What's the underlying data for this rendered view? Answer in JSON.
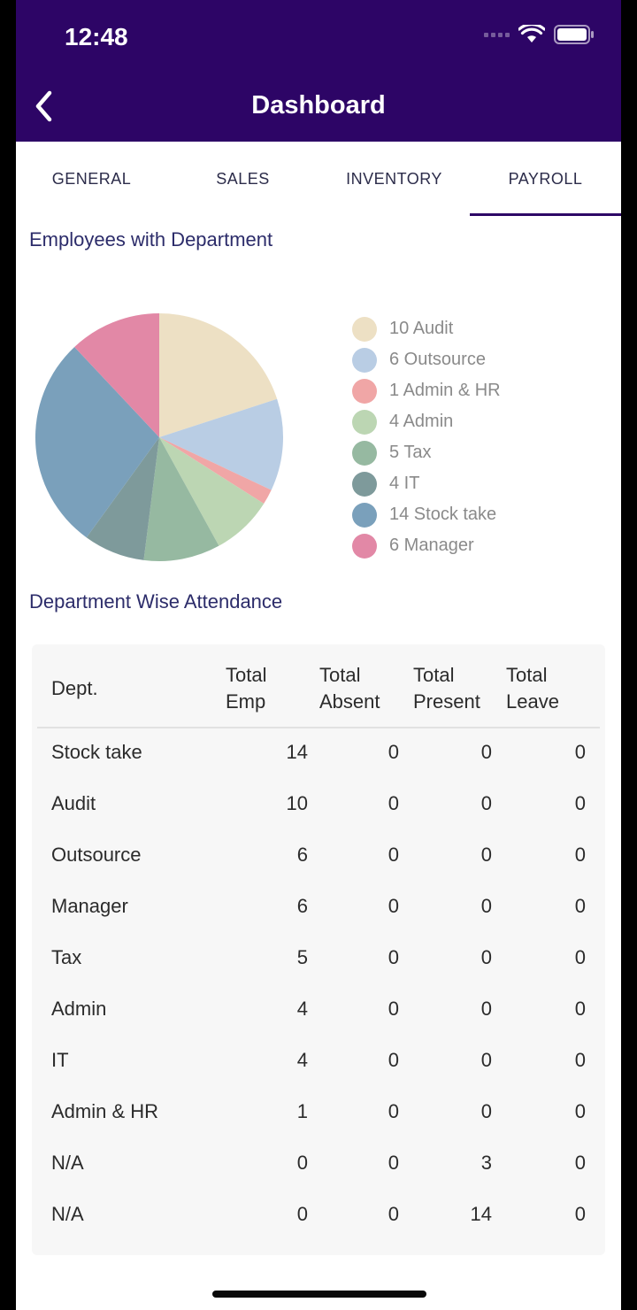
{
  "status_bar": {
    "time": "12:48"
  },
  "header": {
    "title": "Dashboard",
    "back_icon": "chevron-left-icon",
    "background": "#2d0566"
  },
  "tabs": [
    {
      "label": "GENERAL",
      "active": false
    },
    {
      "label": "SALES",
      "active": false
    },
    {
      "label": "INVENTORY",
      "active": false
    },
    {
      "label": "PAYROLL",
      "active": true
    }
  ],
  "employees_section": {
    "title": "Employees with Department"
  },
  "legend": [
    {
      "label": "10 Audit",
      "color": "#ede0c4"
    },
    {
      "label": "6 Outsource",
      "color": "#b9cde4"
    },
    {
      "label": "1 Admin & HR",
      "color": "#f0a6a6"
    },
    {
      "label": "4 Admin",
      "color": "#bcd6b3"
    },
    {
      "label": "5 Tax",
      "color": "#96b9a1"
    },
    {
      "label": "4 IT",
      "color": "#7e9a9b"
    },
    {
      "label": "14 Stock take",
      "color": "#7aa0bb"
    },
    {
      "label": "6 Manager",
      "color": "#e288a6"
    }
  ],
  "chart_data": {
    "type": "pie",
    "categories": [
      "Audit",
      "Outsource",
      "Admin & HR",
      "Admin",
      "Tax",
      "IT",
      "Stock take",
      "Manager"
    ],
    "values": [
      10,
      6,
      1,
      4,
      5,
      4,
      14,
      6
    ],
    "colors": [
      "#ede0c4",
      "#b9cde4",
      "#f0a6a6",
      "#bcd6b3",
      "#96b9a1",
      "#7e9a9b",
      "#7aa0bb",
      "#e288a6"
    ],
    "legend_position": "right"
  },
  "attendance_section": {
    "title": "Department Wise Attendance"
  },
  "attendance_table": {
    "headers": [
      {
        "line1": "Dept.",
        "line2": ""
      },
      {
        "line1": "Total",
        "line2": "Emp"
      },
      {
        "line1": "Total",
        "line2": "Absent"
      },
      {
        "line1": "Total",
        "line2": "Present"
      },
      {
        "line1": "Total",
        "line2": "Leave"
      }
    ],
    "rows": [
      {
        "dept": "Stock take",
        "emp": "14",
        "absent": "0",
        "present": "0",
        "leave": "0"
      },
      {
        "dept": "Audit",
        "emp": "10",
        "absent": "0",
        "present": "0",
        "leave": "0"
      },
      {
        "dept": "Outsource",
        "emp": "6",
        "absent": "0",
        "present": "0",
        "leave": "0"
      },
      {
        "dept": "Manager",
        "emp": "6",
        "absent": "0",
        "present": "0",
        "leave": "0"
      },
      {
        "dept": "Tax",
        "emp": "5",
        "absent": "0",
        "present": "0",
        "leave": "0"
      },
      {
        "dept": "Admin",
        "emp": "4",
        "absent": "0",
        "present": "0",
        "leave": "0"
      },
      {
        "dept": "IT",
        "emp": "4",
        "absent": "0",
        "present": "0",
        "leave": "0"
      },
      {
        "dept": "Admin & HR",
        "emp": "1",
        "absent": "0",
        "present": "0",
        "leave": "0"
      },
      {
        "dept": "N/A",
        "emp": "0",
        "absent": "0",
        "present": "3",
        "leave": "0"
      },
      {
        "dept": "N/A",
        "emp": "0",
        "absent": "0",
        "present": "14",
        "leave": "0"
      }
    ]
  }
}
